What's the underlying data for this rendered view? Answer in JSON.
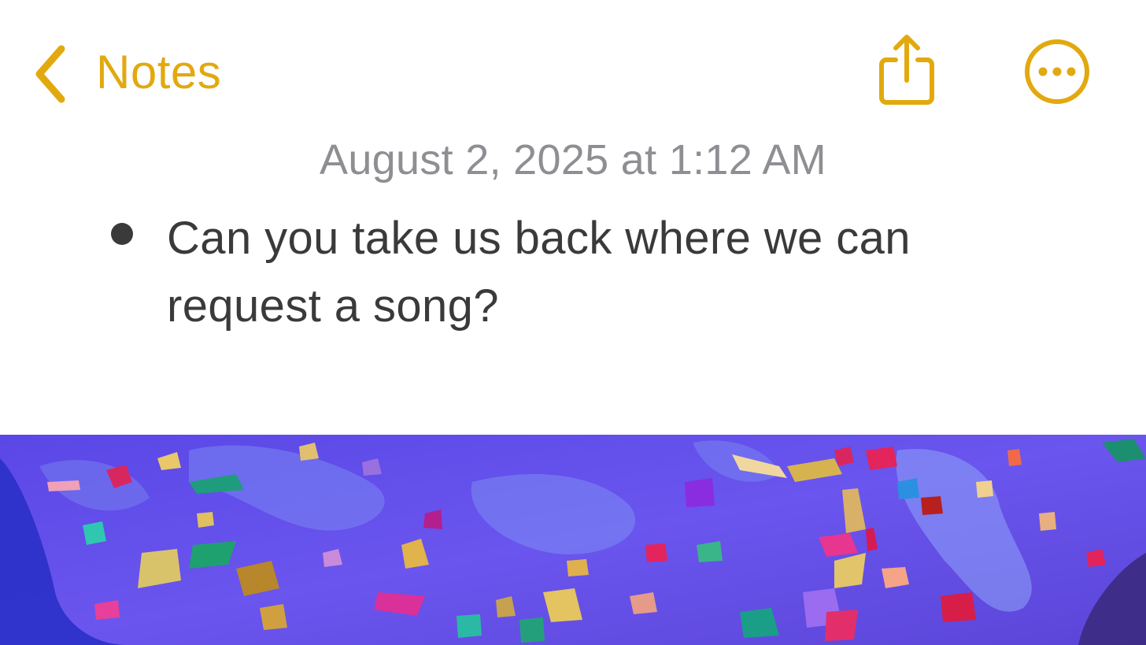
{
  "nav": {
    "back_label": "Notes",
    "back_icon": "chevron-left-icon",
    "share_icon": "share-icon",
    "more_icon": "ellipsis-circle-icon",
    "accent_color": "#E2A90F"
  },
  "note": {
    "date": "August 2, 2025 at 1:12 AM",
    "bullets": [
      "Can you take us back where we can request a song?"
    ]
  },
  "attachment": {
    "type": "photo"
  }
}
